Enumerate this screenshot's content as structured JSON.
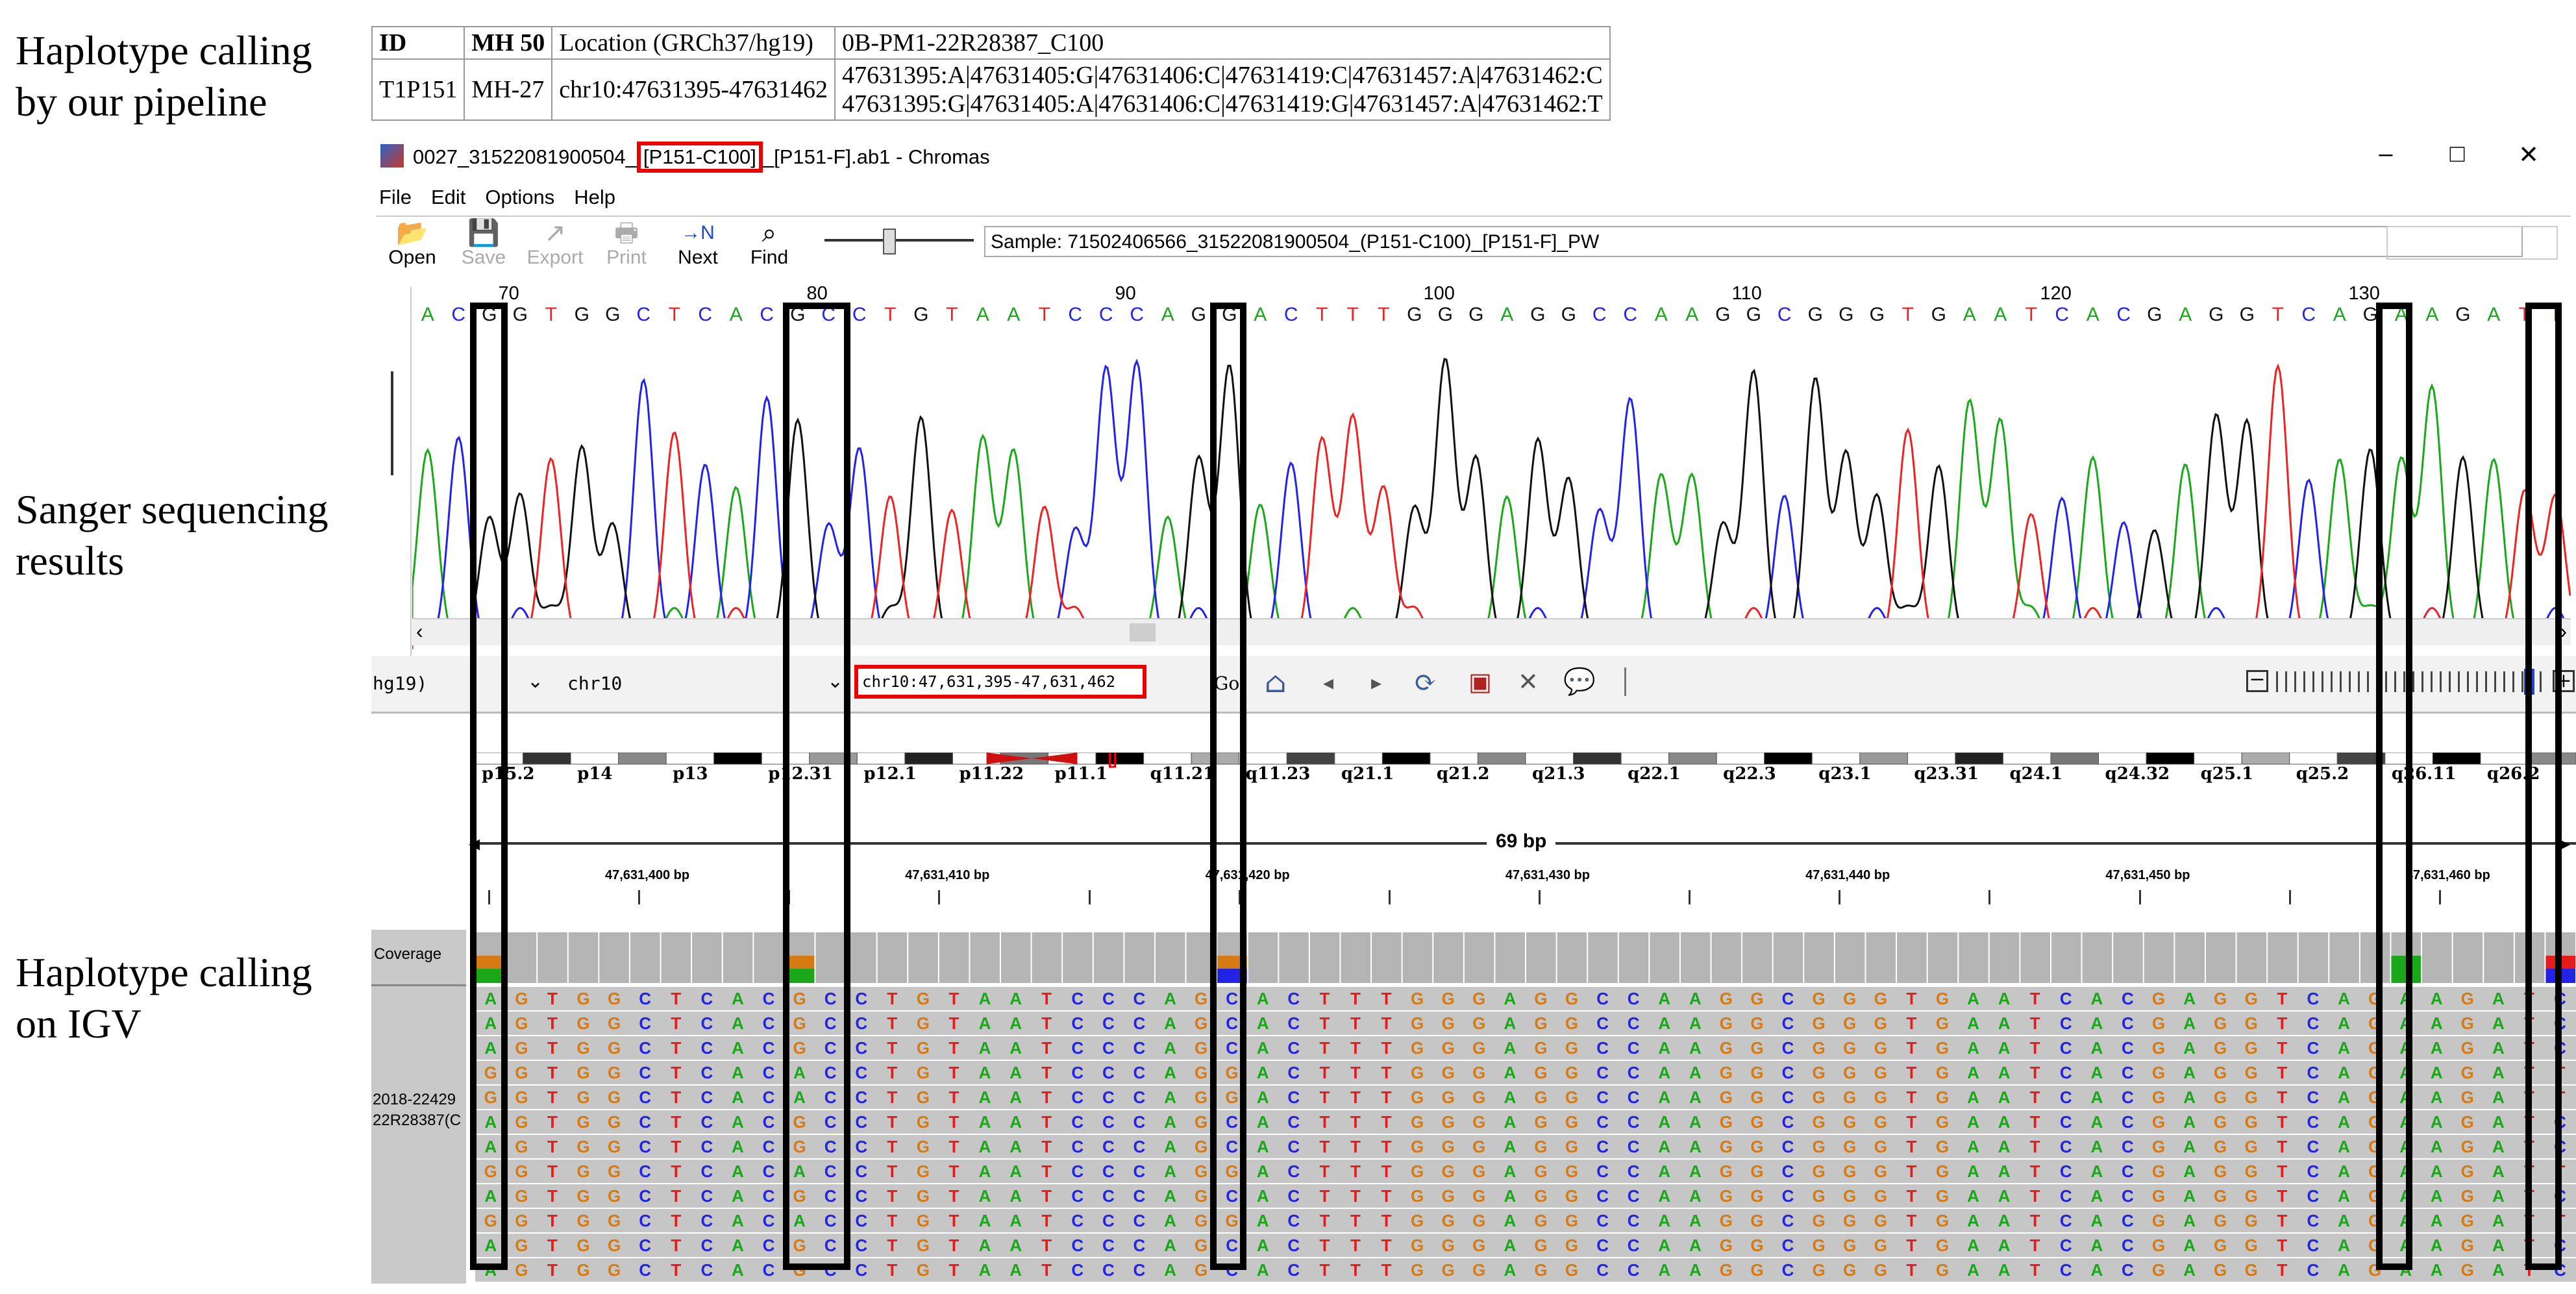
{
  "labels": {
    "pipeline_l1": "Haplotype calling",
    "pipeline_l2": "by our pipeline",
    "sanger_l1": "Sanger sequencing",
    "sanger_l2": "results",
    "igv_l1": "Haplotype calling",
    "igv_l2": "on IGV"
  },
  "hap_table": {
    "headers": [
      "ID",
      "MH 50",
      "Location (GRCh37/hg19)",
      "0B-PM1-22R28387_C100"
    ],
    "row": [
      "T1P151",
      "MH-27",
      "chr10:47631395-47631462"
    ],
    "haplotypes": [
      "47631395:A|47631405:G|47631406:C|47631419:C|47631457:A|47631462:C",
      "47631395:G|47631405:A|47631406:C|47631419:G|47631457:A|47631462:T"
    ]
  },
  "chromas": {
    "title_pre": "0027_31522081900504_",
    "title_box": "[P151-C100]",
    "title_post": "_[P151-F].ab1 - Chromas",
    "window_buttons": [
      "–",
      "□",
      "✕"
    ],
    "menu": [
      "File",
      "Edit",
      "Options",
      "Help"
    ],
    "toolbar": [
      {
        "label": "Open",
        "icon": "📂",
        "enabled": true
      },
      {
        "label": "Save",
        "icon": "💾",
        "enabled": false
      },
      {
        "label": "Export",
        "icon": "↗",
        "enabled": false
      },
      {
        "label": "Print",
        "icon": "🖶",
        "enabled": false
      },
      {
        "label": "Next",
        "icon": "→N",
        "enabled": true
      },
      {
        "label": "Find",
        "icon": "⌕",
        "enabled": true
      }
    ],
    "sample": "Sample: 71502406566_31522081900504_(P151-C100)_[P151-F]_PW",
    "positions": [
      "70",
      "80",
      "90",
      "100",
      "110",
      "120",
      "130"
    ],
    "sequence": "ACGGTGGCTCACGCCTGTAATCCCAGGACTTTGGGAGGCCAAGGCGGGTGAATCACGAGGTCAGAAGATT",
    "base_colors": {
      "A": "#18a818",
      "C": "#2222ee",
      "G": "#111111",
      "T": "#ee2222"
    }
  },
  "igv": {
    "genome": "hg19)",
    "chromosome": "chr10",
    "locus": "chr10:47,631,395-47,631,462",
    "go": "Go",
    "bands": [
      "p15.2",
      "p14",
      "p13",
      "p12.31",
      "p12.1",
      "p11.22",
      "p11.1",
      "q11.21",
      "q11.23",
      "q21.1",
      "q21.2",
      "q21.3",
      "q22.1",
      "q22.3",
      "q23.1",
      "q23.31",
      "q24.1",
      "q24.32",
      "q25.1",
      "q25.2",
      "q26.11",
      "q26.2"
    ],
    "span": "69 bp",
    "ruler": [
      "47,631,400 bp",
      "47,631,410 bp",
      "47,631,420 bp",
      "47,631,430 bp",
      "47,631,440 bp",
      "47,631,450 bp",
      "47,631,460 bp"
    ],
    "coverage": "Coverage",
    "track_name_1": "2018-22429",
    "track_name_2": "22R28387(C",
    "read_ref": "AGTGGCTCACGCCTGTAATCCCAGCACTTTGGGAGGCCAAGGCGGGTGAATCACGAGGTCAGAAGATC",
    "read_variants": [
      "G",
      "A",
      "C",
      "G",
      "A",
      "T"
    ],
    "read_pattern": [
      [
        "A",
        "G",
        "C",
        "C",
        "A",
        "C"
      ],
      [
        "A",
        "G",
        "C",
        "C",
        "A",
        "C"
      ],
      [
        "A",
        "G",
        "C",
        "C",
        "A",
        "C"
      ],
      [
        "G",
        "A",
        "C",
        "G",
        "A",
        "T"
      ],
      [
        "G",
        "A",
        "C",
        "G",
        "A",
        "T"
      ],
      [
        "A",
        "G",
        "C",
        "C",
        "A",
        "C"
      ],
      [
        "A",
        "G",
        "C",
        "C",
        "A",
        "C"
      ],
      [
        "G",
        "A",
        "C",
        "G",
        "A",
        "T"
      ],
      [
        "A",
        "G",
        "C",
        "C",
        "A",
        "C"
      ],
      [
        "G",
        "A",
        "C",
        "G",
        "A",
        "T"
      ],
      [
        "A",
        "G",
        "C",
        "C",
        "A",
        "C"
      ],
      [
        "A",
        "G",
        "C",
        "C",
        "A",
        "C"
      ]
    ],
    "base_colors": {
      "A": "#1aa81a",
      "C": "#2323e6",
      "G": "#d67a14",
      "T": "#e81b1b"
    }
  }
}
